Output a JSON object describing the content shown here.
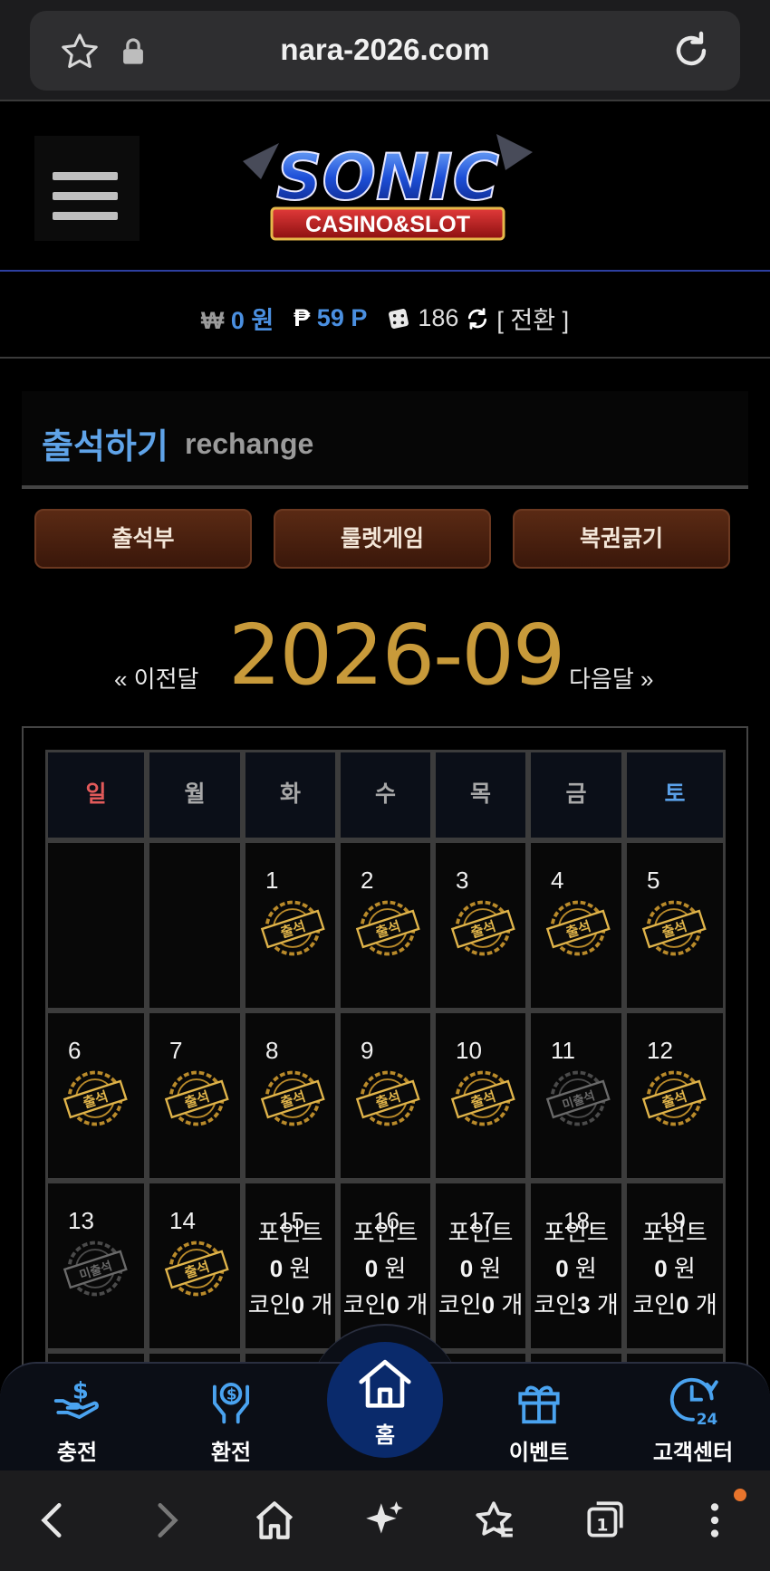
{
  "browser": {
    "url": "nara-2026.com",
    "tab_count": "1"
  },
  "header": {
    "logo_title": "SONIC",
    "logo_subtitle": "CASINO&SLOT"
  },
  "wallet": {
    "money_symbol": "₩",
    "money_value": "0 원",
    "point_symbol": "₱",
    "point_value": "59 P",
    "coin_value": "186",
    "convert_label": "[ 전환 ]"
  },
  "section": {
    "title": "출석하기",
    "subtitle": "rechange"
  },
  "tabs": [
    "출석부",
    "룰렛게임",
    "복권긁기"
  ],
  "calendar": {
    "prev_label": "« 이전달",
    "month": "2026-09",
    "next_label": "다음달 »",
    "weekdays": [
      "일",
      "월",
      "화",
      "수",
      "목",
      "금",
      "토"
    ],
    "stamp_attended": "출석",
    "stamp_missed": "미출석",
    "days": [
      {
        "day": "1",
        "status": "attended"
      },
      {
        "day": "2",
        "status": "attended"
      },
      {
        "day": "3",
        "status": "attended"
      },
      {
        "day": "4",
        "status": "attended"
      },
      {
        "day": "5",
        "status": "attended"
      },
      {
        "day": "6",
        "status": "attended"
      },
      {
        "day": "7",
        "status": "attended"
      },
      {
        "day": "8",
        "status": "attended"
      },
      {
        "day": "9",
        "status": "attended"
      },
      {
        "day": "10",
        "status": "attended"
      },
      {
        "day": "11",
        "status": "missed"
      },
      {
        "day": "12",
        "status": "attended"
      },
      {
        "day": "13",
        "status": "missed"
      },
      {
        "day": "14",
        "status": "attended"
      },
      {
        "day": "15",
        "points_label": "포인트",
        "points_value": "0",
        "won": "원",
        "coin_label": "코인",
        "coin_value": "0",
        "unit": "개"
      },
      {
        "day": "16",
        "points_label": "포인트",
        "points_value": "0",
        "won": "원",
        "coin_label": "코인",
        "coin_value": "0",
        "unit": "개"
      },
      {
        "day": "17",
        "points_label": "포인트",
        "points_value": "0",
        "won": "원",
        "coin_label": "코인",
        "coin_value": "0",
        "unit": "개"
      },
      {
        "day": "18",
        "points_label": "포인트",
        "points_value": "0",
        "won": "원",
        "coin_label": "코인",
        "coin_value": "3",
        "unit": "개"
      },
      {
        "day": "19",
        "points_label": "포인트",
        "points_value": "0",
        "won": "원",
        "coin_label": "코인",
        "coin_value": "0",
        "unit": "개"
      }
    ]
  },
  "app_nav": {
    "charge": "충전",
    "exchange": "환전",
    "home": "홈",
    "event": "이벤트",
    "support": "고객센터"
  },
  "colors": {
    "accent_blue": "#4a8fe0",
    "gold": "#c89a3a",
    "tab_brown": "#5a2a14"
  }
}
